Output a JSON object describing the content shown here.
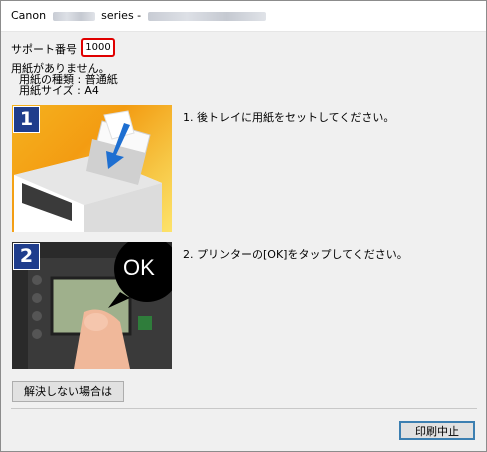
{
  "window": {
    "title_prefix": "Canon",
    "title_suffix": "series -"
  },
  "support": {
    "label": "サポート番号",
    "code": "1000"
  },
  "message": {
    "line1": "用紙がありません。",
    "line2": "用紙の種類 : 普通紙",
    "line3": "用紙サイズ : A4"
  },
  "steps": [
    {
      "badge": "1",
      "text": "1.  後トレイに用紙をセットしてください。",
      "image": "printer-rear-tray-photo"
    },
    {
      "badge": "2",
      "text": "2.  プリンターの[OK]をタップしてください。",
      "image": "printer-panel-ok-photo",
      "ok_label": "OK"
    }
  ],
  "buttons": {
    "unresolved": "解決しない場合は",
    "cancel_print": "印刷中止"
  },
  "colors": {
    "support_code_border": "#e00000",
    "step_badge": "#1f3d8c",
    "step1_background": "#f7a21b",
    "default_button_border": "#3c7fb1"
  }
}
